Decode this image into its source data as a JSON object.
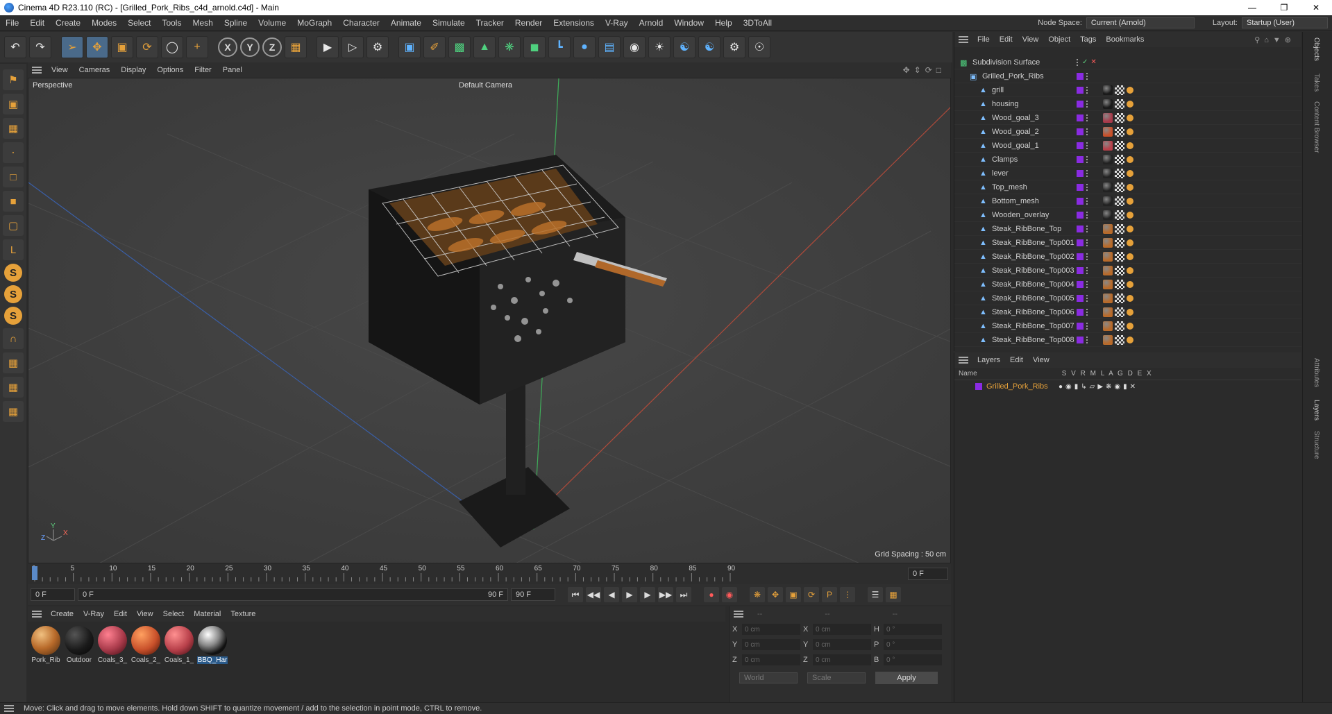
{
  "window": {
    "title": "Cinema 4D R23.110 (RC) - [Grilled_Pork_Ribs_c4d_arnold.c4d] - Main"
  },
  "menubar": {
    "items": [
      "File",
      "Edit",
      "Create",
      "Modes",
      "Select",
      "Tools",
      "Mesh",
      "Spline",
      "Volume",
      "MoGraph",
      "Character",
      "Animate",
      "Simulate",
      "Tracker",
      "Render",
      "Extensions",
      "V-Ray",
      "Arnold",
      "Window",
      "Help",
      "3DToAll"
    ],
    "node_space_label": "Node Space:",
    "node_space_value": "Current (Arnold)",
    "layout_label": "Layout:",
    "layout_value": "Startup (User)"
  },
  "viewport": {
    "menu": [
      "View",
      "Cameras",
      "Display",
      "Options",
      "Filter",
      "Panel"
    ],
    "name": "Perspective",
    "camera": "Default Camera",
    "grid_spacing": "Grid Spacing : 50 cm"
  },
  "timeline": {
    "ticks": [
      "0",
      "5",
      "10",
      "15",
      "20",
      "25",
      "30",
      "35",
      "40",
      "45",
      "50",
      "55",
      "60",
      "65",
      "70",
      "75",
      "80",
      "85",
      "90"
    ],
    "current_frame": "0 F"
  },
  "playback": {
    "start": "0 F",
    "current": "0 F",
    "end_inner": "90 F",
    "end": "90 F"
  },
  "material_manager": {
    "menu": [
      "Create",
      "V-Ray",
      "Edit",
      "View",
      "Select",
      "Material",
      "Texture"
    ],
    "materials": [
      {
        "name": "Pork_Rib",
        "color": "#b86a2a"
      },
      {
        "name": "Outdoor",
        "color": "#1a1a1a"
      },
      {
        "name": "Coals_3_",
        "color": "#a83a4a"
      },
      {
        "name": "Coals_2_",
        "color": "#c8502a"
      },
      {
        "name": "Coals_1_",
        "color": "#b8404a"
      },
      {
        "name": "BBQ_Har",
        "color": "#dddddd"
      }
    ]
  },
  "coordinates": {
    "headers": [
      "--",
      "--",
      "--"
    ],
    "rows": [
      {
        "a": "X",
        "av": "0 cm",
        "b": "X",
        "bv": "0 cm",
        "c": "H",
        "cv": "0 °"
      },
      {
        "a": "Y",
        "av": "0 cm",
        "b": "Y",
        "bv": "0 cm",
        "c": "P",
        "cv": "0 °"
      },
      {
        "a": "Z",
        "av": "0 cm",
        "b": "Z",
        "bv": "0 cm",
        "c": "B",
        "cv": "0 °"
      }
    ],
    "mode": "World",
    "scale": "Scale",
    "apply": "Apply"
  },
  "object_manager": {
    "menu": [
      "File",
      "Edit",
      "View",
      "Object",
      "Tags",
      "Bookmarks"
    ],
    "root": "Subdivision Surface",
    "group": "Grilled_Pork_Ribs",
    "objects": [
      "grill",
      "housing",
      "Wood_goal_3",
      "Wood_goal_2",
      "Wood_goal_1",
      "Clamps",
      "lever",
      "Top_mesh",
      "Bottom_mesh",
      "Wooden_overlay",
      "Steak_RibBone_Top",
      "Steak_RibBone_Top001",
      "Steak_RibBone_Top002",
      "Steak_RibBone_Top003",
      "Steak_RibBone_Top004",
      "Steak_RibBone_Top005",
      "Steak_RibBone_Top006",
      "Steak_RibBone_Top007",
      "Steak_RibBone_Top008"
    ]
  },
  "layer_manager": {
    "menu": [
      "Layers",
      "Edit",
      "View"
    ],
    "header_name": "Name",
    "header_flags": "S V R M L A G D E X",
    "layers": [
      "Grilled_Pork_Ribs"
    ]
  },
  "side_tabs": [
    "Objects",
    "Takes",
    "Content Browser",
    "Attributes",
    "Layers",
    "Structure"
  ],
  "status": "Move: Click and drag to move elements. Hold down SHIFT to quantize movement / add to the selection in point mode, CTRL to remove."
}
